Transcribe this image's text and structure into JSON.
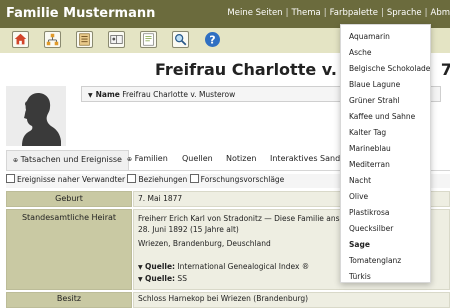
{
  "header": {
    "site_title": "Familie Mustermann",
    "menu": [
      "Meine Seiten",
      "Thema",
      "Farbpalette",
      "Sprache",
      "Abm"
    ]
  },
  "toolbar": {
    "icons": [
      "home-icon",
      "family-tree-icon",
      "list-icon",
      "address-book-icon",
      "document-icon",
      "search-icon",
      "help-icon"
    ]
  },
  "person": {
    "title": "Freifrau Charlotte v. Muste",
    "title_tail": "7–",
    "name_label": "Name",
    "name_value": "Freifrau Charlotte v. Musterow"
  },
  "tabs": [
    "Tatsachen und Ereignisse",
    "Familien",
    "Quellen",
    "Notizen",
    "Interaktives Sanduh"
  ],
  "filters": [
    "Ereignisse naher Verwandter",
    "Beziehungen",
    "Forschungsvorschläge"
  ],
  "facts": [
    {
      "label": "Geburt",
      "lines": [
        "7. Mai 1877"
      ]
    },
    {
      "label": "Standesamtliche Heirat",
      "lines": [
        "Freiherr Erich Karl von Stradonitz — Diese Familie ansehen",
        "28. Juni 1892 (15 Jahre alt)",
        "Wriezen, Brandenburg, Deuschland",
        "Quelle: International Genealogical Index ®",
        "Quelle: SS"
      ]
    },
    {
      "label": "Besitz",
      "lines": [
        "Schloss Harnekop bei Wriezen (Brandenburg)"
      ]
    }
  ],
  "source_prefix": "Quelle:",
  "palette_dropdown": {
    "items": [
      "Aquamarin",
      "Asche",
      "Belgische Schokolade",
      "Blaue Lagune",
      "Grüner Strahl",
      "Kaffee und Sahne",
      "Kalter Tag",
      "Marineblau",
      "Mediterran",
      "Nacht",
      "Olive",
      "Plastikrosa",
      "Quecksilber",
      "Sage",
      "Tomatenglanz",
      "Türkis"
    ],
    "selected": "Sage"
  }
}
